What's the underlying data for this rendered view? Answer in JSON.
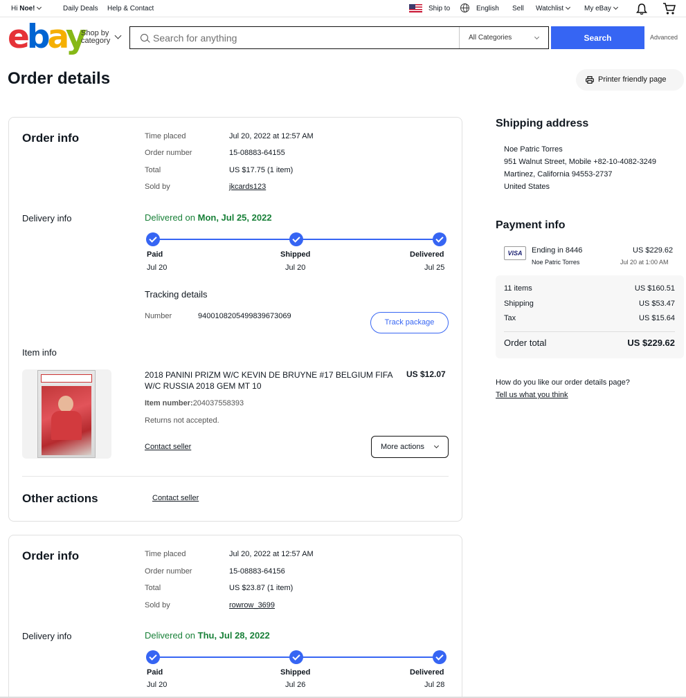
{
  "topbar": {
    "greeting_prefix": "Hi",
    "user_name": "Noe!",
    "daily_deals": "Daily Deals",
    "help_contact": "Help & Contact",
    "ship_to": "Ship to",
    "language": "English",
    "sell": "Sell",
    "watchlist": "Watchlist",
    "my_ebay": "My eBay"
  },
  "header": {
    "logo": {
      "e": "e",
      "b": "b",
      "a": "a",
      "y": "y"
    },
    "shop_by_line1": "Shop by",
    "shop_by_line2": "category",
    "search_placeholder": "Search for anything",
    "category": "All Categories",
    "search_button": "Search",
    "advanced": "Advanced"
  },
  "page": {
    "title": "Order details",
    "print_button": "Printer friendly page"
  },
  "orders": [
    {
      "order_info_heading": "Order info",
      "labels": {
        "time_placed": "Time placed",
        "order_number": "Order number",
        "total": "Total",
        "sold_by": "Sold by"
      },
      "time_placed": "Jul 20, 2022 at 12:57 AM",
      "order_number": "15-08883-64155",
      "total": "US $17.75 (1 item)",
      "sold_by": "jkcards123",
      "delivery_heading": "Delivery info",
      "delivered_prefix": "Delivered on",
      "delivered_date": "Mon, Jul 25, 2022",
      "steps": [
        {
          "name": "Paid",
          "date": "Jul 20"
        },
        {
          "name": "Shipped",
          "date": "Jul 20"
        },
        {
          "name": "Delivered",
          "date": "Jul 25"
        }
      ],
      "tracking_heading": "Tracking details",
      "tracking_label": "Number",
      "tracking_number": "9400108205499839673069",
      "track_button": "Track package",
      "item_heading": "Item info",
      "item_title": "2018 PANINI PRIZM W/C KEVIN DE BRUYNE #17 BELGIUM FIFA W/C RUSSIA 2018 GEM MT 10",
      "item_price": "US $12.07",
      "item_number_label": "Item number:",
      "item_number": "204037558393",
      "returns": "Returns not accepted.",
      "contact_seller": "Contact seller",
      "more_actions": "More actions",
      "other_actions_heading": "Other actions",
      "other_contact_seller": "Contact seller"
    },
    {
      "order_info_heading": "Order info",
      "labels": {
        "time_placed": "Time placed",
        "order_number": "Order number",
        "total": "Total",
        "sold_by": "Sold by"
      },
      "time_placed": "Jul 20, 2022 at 12:57 AM",
      "order_number": "15-08883-64156",
      "total": "US $23.87 (1 item)",
      "sold_by": "rowrow_3699",
      "delivery_heading": "Delivery info",
      "delivered_prefix": "Delivered on",
      "delivered_date": "Thu, Jul 28, 2022",
      "steps": [
        {
          "name": "Paid",
          "date": "Jul 20"
        },
        {
          "name": "Shipped",
          "date": "Jul 26"
        },
        {
          "name": "Delivered",
          "date": "Jul 28"
        }
      ]
    }
  ],
  "shipping": {
    "heading": "Shipping address",
    "name": "Noe Patric Torres",
    "street": "951 Walnut Street, Mobile +82-10-4082-3249",
    "city": "Martinez, California 94553-2737",
    "country": "United States"
  },
  "payment": {
    "heading": "Payment info",
    "card_brand": "VISA",
    "ending": "Ending in 8446",
    "holder": "Noe Patric Torres",
    "amount": "US $229.62",
    "date": "Jul 20 at 1:00 AM",
    "summary": [
      {
        "label": "11 items",
        "value": "US $160.51"
      },
      {
        "label": "Shipping",
        "value": "US $53.47"
      },
      {
        "label": "Tax",
        "value": "US $15.64"
      }
    ],
    "total_label": "Order total",
    "total_value": "US $229.62"
  },
  "feedback": {
    "question": "How do you like our order details page?",
    "link": "Tell us what you think"
  }
}
